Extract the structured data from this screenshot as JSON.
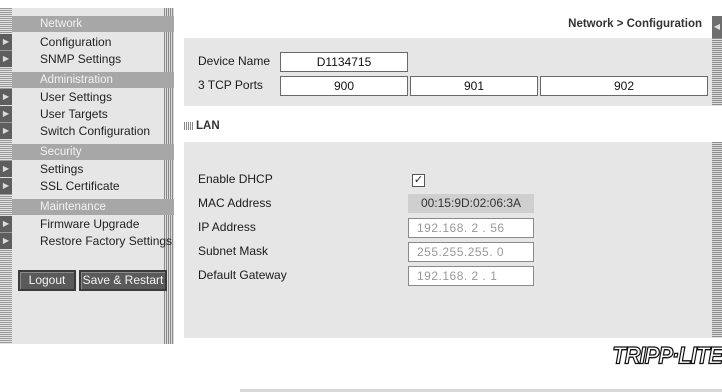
{
  "sidebar": {
    "sections": [
      {
        "title": "Network",
        "items": [
          "Configuration",
          "SNMP Settings"
        ]
      },
      {
        "title": "Administration",
        "items": [
          "User Settings",
          "User Targets",
          "Switch Configuration"
        ]
      },
      {
        "title": "Security",
        "items": [
          "Settings",
          "SSL Certificate"
        ]
      },
      {
        "title": "Maintenance",
        "items": [
          "Firmware Upgrade",
          "Restore Factory Settings"
        ]
      }
    ],
    "logout_label": "Logout",
    "save_restart_label": "Save & Restart"
  },
  "header": {
    "breadcrumb": "Network > Configuration"
  },
  "device": {
    "name_label": "Device Name",
    "name_value": "D1134715",
    "ports_label": "3 TCP Ports",
    "ports": [
      "900",
      "901",
      "902"
    ]
  },
  "lan": {
    "title": "LAN",
    "dhcp_label": "Enable DHCP",
    "dhcp_checked": "✓",
    "mac_label": "MAC Address",
    "mac_value": "00:15:9D:02:06:3A",
    "ip_label": "IP Address",
    "ip_value": "192.168. 2 . 56",
    "subnet_label": "Subnet Mask",
    "subnet_value": "255.255.255. 0",
    "gateway_label": "Default Gateway",
    "gateway_value": "192.168. 2 . 1"
  },
  "brand": {
    "logo_text": "TRIPP·LITE"
  }
}
